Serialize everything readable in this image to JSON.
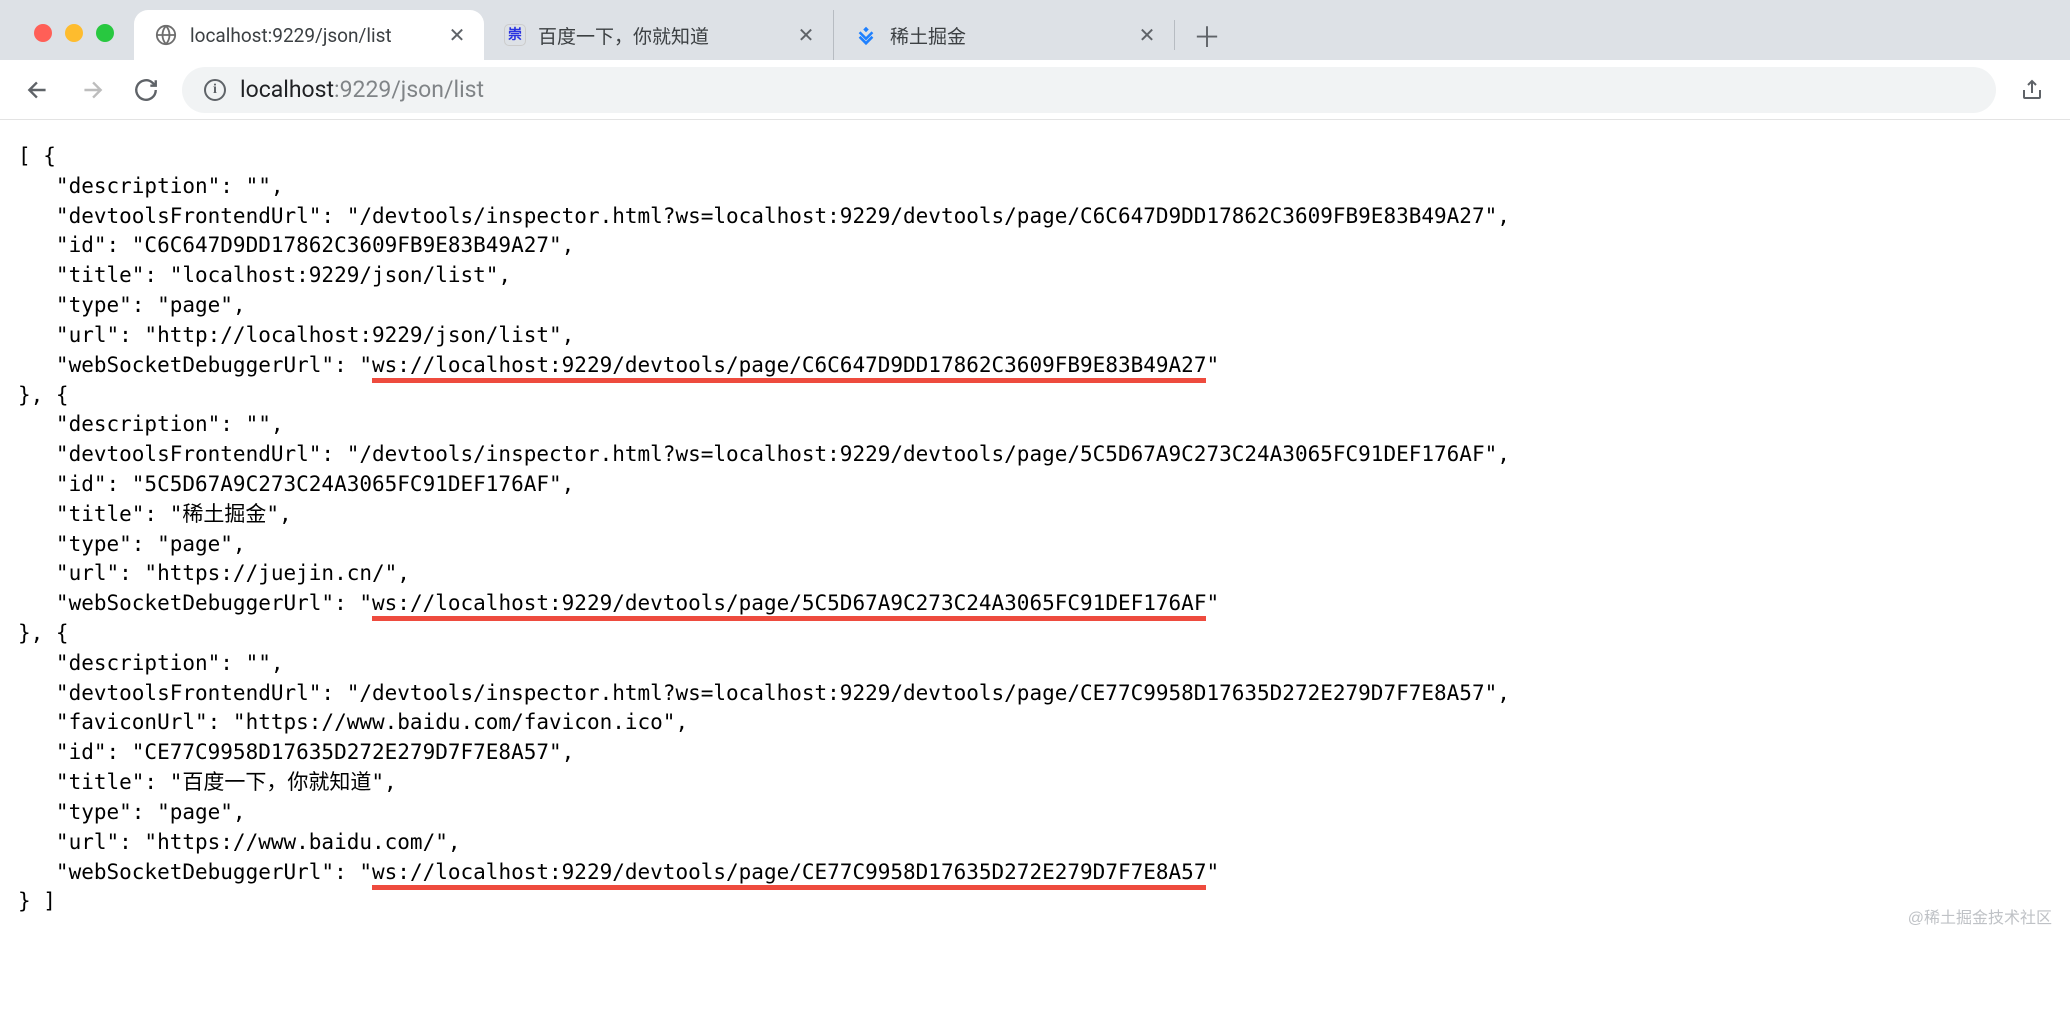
{
  "window": {
    "tabs": [
      {
        "title": "localhost:9229/json/list",
        "favicon": "globe",
        "active": true
      },
      {
        "title": "百度一下，你就知道",
        "favicon": "baidu",
        "active": false
      },
      {
        "title": "稀土掘金",
        "favicon": "juejin",
        "active": false
      }
    ]
  },
  "addressbar": {
    "host": "localhost",
    "rest": ":9229/json/list"
  },
  "page": {
    "items": [
      {
        "description": "",
        "devtoolsFrontendUrl": "/devtools/inspector.html?ws=localhost:9229/devtools/page/C6C647D9DD17862C3609FB9E83B49A27",
        "id": "C6C647D9DD17862C3609FB9E83B49A27",
        "title": "localhost:9229/json/list",
        "type": "page",
        "url": "http://localhost:9229/json/list",
        "webSocketDebuggerUrl": "ws://localhost:9229/devtools/page/C6C647D9DD17862C3609FB9E83B49A27"
      },
      {
        "description": "",
        "devtoolsFrontendUrl": "/devtools/inspector.html?ws=localhost:9229/devtools/page/5C5D67A9C273C24A3065FC91DEF176AF",
        "id": "5C5D67A9C273C24A3065FC91DEF176AF",
        "title": "稀土掘金",
        "type": "page",
        "url": "https://juejin.cn/",
        "webSocketDebuggerUrl": "ws://localhost:9229/devtools/page/5C5D67A9C273C24A3065FC91DEF176AF"
      },
      {
        "description": "",
        "devtoolsFrontendUrl": "/devtools/inspector.html?ws=localhost:9229/devtools/page/CE77C9958D17635D272E279D7F7E8A57",
        "faviconUrl": "https://www.baidu.com/favicon.ico",
        "id": "CE77C9958D17635D272E279D7F7E8A57",
        "title": "百度一下，你就知道",
        "type": "page",
        "url": "https://www.baidu.com/",
        "webSocketDebuggerUrl": "ws://localhost:9229/devtools/page/CE77C9958D17635D272E279D7F7E8A57"
      }
    ]
  },
  "watermark": "@稀土掘金技术社区"
}
